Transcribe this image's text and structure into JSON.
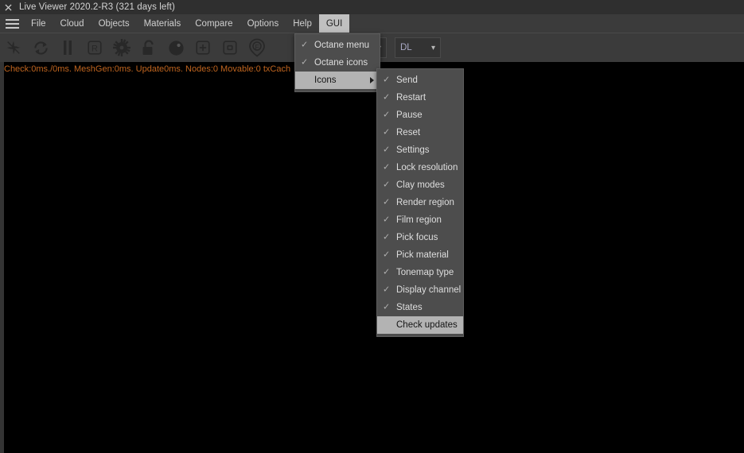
{
  "titlebar": {
    "close_icon": "close-icon",
    "title": "Live Viewer 2020.2-R3 (321 days left)"
  },
  "menubar": {
    "hamburger_icon": "hamburger-icon",
    "items": [
      {
        "label": "File",
        "active": false
      },
      {
        "label": "Cloud",
        "active": false
      },
      {
        "label": "Objects",
        "active": false
      },
      {
        "label": "Materials",
        "active": false
      },
      {
        "label": "Compare",
        "active": false
      },
      {
        "label": "Options",
        "active": false
      },
      {
        "label": "Help",
        "active": false
      },
      {
        "label": "GUI",
        "active": true
      }
    ]
  },
  "toolbar": {
    "icons": [
      "send-icon",
      "restart-icon",
      "pause-icon",
      "reset-r-icon",
      "settings-gear-icon",
      "lock-resolution-icon",
      "clay-modes-icon",
      "render-region-icon",
      "film-region-icon",
      "pick-focus-icon"
    ],
    "combo_empty_value": "",
    "combo_dl_value": "DL",
    "chevron_icon": "chevron-down-icon"
  },
  "status": {
    "text": "Check:0ms./0ms. MeshGen:0ms. Update0ms. Nodes:0 Movable:0 txCach",
    "color": "#c0651f"
  },
  "gui_menu": {
    "items": [
      {
        "label": "Octane menu",
        "checked": true,
        "submenu": false,
        "highlight": false
      },
      {
        "label": "Octane icons",
        "checked": true,
        "submenu": false,
        "highlight": false
      },
      {
        "label": "Icons",
        "checked": false,
        "submenu": true,
        "highlight": true
      }
    ]
  },
  "icons_submenu": {
    "items": [
      {
        "label": "Send",
        "checked": true,
        "highlight": false
      },
      {
        "label": "Restart",
        "checked": true,
        "highlight": false
      },
      {
        "label": "Pause",
        "checked": true,
        "highlight": false
      },
      {
        "label": "Reset",
        "checked": true,
        "highlight": false
      },
      {
        "label": "Settings",
        "checked": true,
        "highlight": false
      },
      {
        "label": "Lock resolution",
        "checked": true,
        "highlight": false
      },
      {
        "label": "Clay modes",
        "checked": true,
        "highlight": false
      },
      {
        "label": "Render region",
        "checked": true,
        "highlight": false
      },
      {
        "label": "Film region",
        "checked": true,
        "highlight": false
      },
      {
        "label": "Pick focus",
        "checked": true,
        "highlight": false
      },
      {
        "label": "Pick material",
        "checked": true,
        "highlight": false
      },
      {
        "label": "Tonemap type",
        "checked": true,
        "highlight": false
      },
      {
        "label": "Display channel",
        "checked": true,
        "highlight": false
      },
      {
        "label": "States",
        "checked": true,
        "highlight": false
      },
      {
        "label": "Check updates",
        "checked": false,
        "highlight": true
      }
    ]
  },
  "colors": {
    "titlebar_bg": "#2f2f2f",
    "menubar_bg": "#3b3b3b",
    "toolbar_bg": "#3b3b3b",
    "viewport_bg": "#000000",
    "menu_bg": "#4d4d4d",
    "highlight_bg": "#b3b3b3",
    "status_text": "#c0651f"
  }
}
